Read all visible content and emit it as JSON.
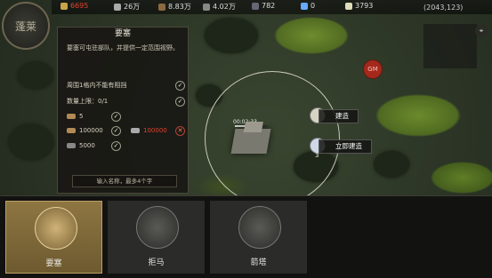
{
  "hud": {
    "avatar_label": "蓬莱",
    "resources": [
      {
        "name": "gold-icon",
        "value": "6695",
        "color": "#c9614a"
      },
      {
        "name": "food-icon",
        "value": "26万",
        "color": "#dddddd"
      },
      {
        "name": "wood-icon",
        "value": "8.83万",
        "color": "#dddddd"
      },
      {
        "name": "stone-icon",
        "value": "4.02万",
        "color": "#dddddd"
      },
      {
        "name": "iron-icon",
        "value": "782",
        "color": "#dddddd"
      },
      {
        "name": "gem-icon",
        "value": "0",
        "color": "#dddddd"
      },
      {
        "name": "coin-icon",
        "value": "3793",
        "color": "#dddddd"
      }
    ],
    "coordinates": "(2043,123)"
  },
  "panel": {
    "title": "要塞",
    "description": "要塞可屯驻部队，并提供一定范围视野。",
    "condition_1": "周围1格内不能有阻挡",
    "condition_2": "数量上限：0/1",
    "cost_1": "5",
    "cost_2": "100000",
    "cost_3": "100000",
    "cost_4": "5000",
    "name_placeholder": "输入名称，最多4个字"
  },
  "map": {
    "timer": "00:02:33",
    "gm_label": "GM",
    "build_label": "建造",
    "instant_build_label": "立即建造",
    "instant_build_cost": "3"
  },
  "cards": [
    {
      "label": "要塞",
      "selected": true
    },
    {
      "label": "拒马",
      "selected": false
    },
    {
      "label": "箭塔",
      "selected": false
    }
  ]
}
